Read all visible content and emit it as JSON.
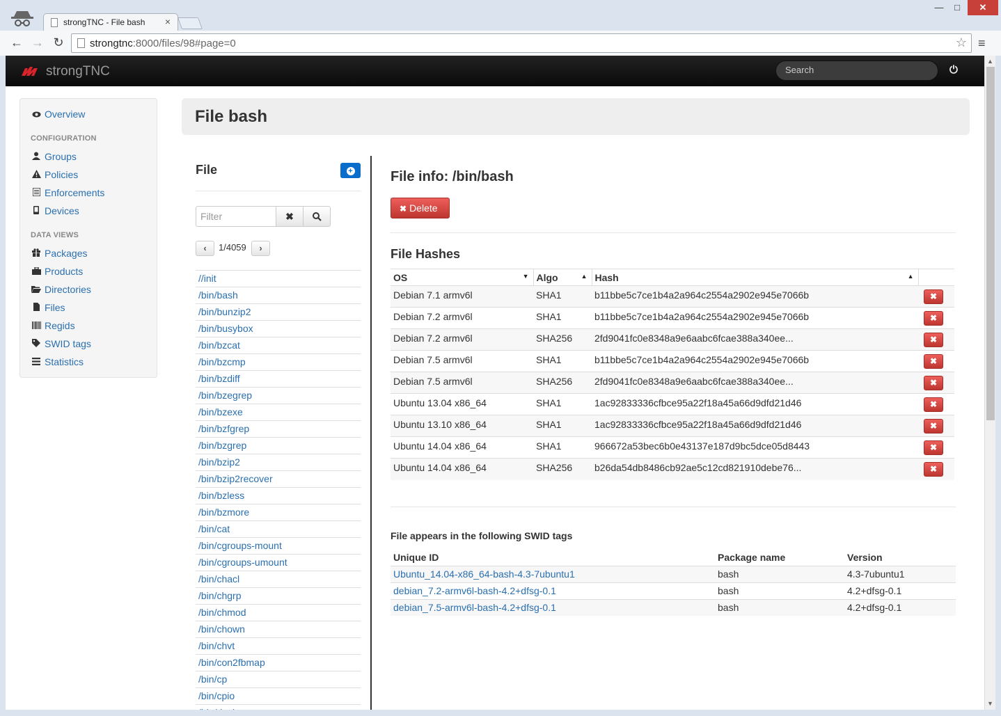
{
  "browser": {
    "tab_title": "strongTNC - File bash",
    "tab_close": "×",
    "url_host": "strongtnc",
    "url_rest": ":8000/files/98#page=0",
    "win_min": "—",
    "win_max": "□",
    "win_close": "✕",
    "back": "←",
    "forward": "→",
    "reload": "↻",
    "star": "☆",
    "menu": "≡"
  },
  "navbar": {
    "brand": "strongTNC",
    "search_placeholder": "Search",
    "power_icon": "⏻",
    "accent": "#d9242b"
  },
  "sidebar": {
    "overview": "Overview",
    "config_header": "CONFIGURATION",
    "config_items": [
      {
        "label": "Groups",
        "icon": "user-icon"
      },
      {
        "label": "Policies",
        "icon": "warning-icon"
      },
      {
        "label": "Enforcements",
        "icon": "list-icon"
      },
      {
        "label": "Devices",
        "icon": "phone-icon"
      }
    ],
    "data_header": "DATA VIEWS",
    "data_items": [
      {
        "label": "Packages",
        "icon": "gift-icon"
      },
      {
        "label": "Products",
        "icon": "briefcase-icon"
      },
      {
        "label": "Directories",
        "icon": "folder-icon"
      },
      {
        "label": "Files",
        "icon": "file-icon"
      },
      {
        "label": "Regids",
        "icon": "barcode-icon"
      },
      {
        "label": "SWID tags",
        "icon": "tag-icon"
      },
      {
        "label": "Statistics",
        "icon": "list-icon"
      }
    ]
  },
  "page": {
    "title": "File bash"
  },
  "file_panel": {
    "title": "File",
    "filter_placeholder": "Filter",
    "clear_glyph": "✖",
    "search_glyph": "⌕",
    "prev_glyph": "‹",
    "next_glyph": "›",
    "page_indicator": "1/4059",
    "files": [
      "//init",
      "/bin/bash",
      "/bin/bunzip2",
      "/bin/busybox",
      "/bin/bzcat",
      "/bin/bzcmp",
      "/bin/bzdiff",
      "/bin/bzegrep",
      "/bin/bzexe",
      "/bin/bzfgrep",
      "/bin/bzgrep",
      "/bin/bzip2",
      "/bin/bzip2recover",
      "/bin/bzless",
      "/bin/bzmore",
      "/bin/cat",
      "/bin/cgroups-mount",
      "/bin/cgroups-umount",
      "/bin/chacl",
      "/bin/chgrp",
      "/bin/chmod",
      "/bin/chown",
      "/bin/chvt",
      "/bin/con2fbmap",
      "/bin/cp",
      "/bin/cpio",
      "/bin/dash"
    ]
  },
  "file_info": {
    "title": "File info: /bin/bash",
    "delete_label": "Delete",
    "hashes_title": "File Hashes",
    "hash_columns": [
      "OS",
      "Algo",
      "Hash",
      ""
    ],
    "hashes": [
      {
        "os": "Debian 7.1 armv6l",
        "algo": "SHA1",
        "hash": "b11bbe5c7ce1b4a2a964c2554a2902e945e7066b"
      },
      {
        "os": "Debian 7.2 armv6l",
        "algo": "SHA1",
        "hash": "b11bbe5c7ce1b4a2a964c2554a2902e945e7066b"
      },
      {
        "os": "Debian 7.2 armv6l",
        "algo": "SHA256",
        "hash": "2fd9041fc0e8348a9e6aabc6fcae388a340ee..."
      },
      {
        "os": "Debian 7.5 armv6l",
        "algo": "SHA1",
        "hash": "b11bbe5c7ce1b4a2a964c2554a2902e945e7066b"
      },
      {
        "os": "Debian 7.5 armv6l",
        "algo": "SHA256",
        "hash": "2fd9041fc0e8348a9e6aabc6fcae388a340ee..."
      },
      {
        "os": "Ubuntu 13.04 x86_64",
        "algo": "SHA1",
        "hash": "1ac92833336cfbce95a22f18a45a66d9dfd21d46"
      },
      {
        "os": "Ubuntu 13.10 x86_64",
        "algo": "SHA1",
        "hash": "1ac92833336cfbce95a22f18a45a66d9dfd21d46"
      },
      {
        "os": "Ubuntu 14.04 x86_64",
        "algo": "SHA1",
        "hash": "966672a53bec6b0e43137e187d9bc5dce05d8443"
      },
      {
        "os": "Ubuntu 14.04 x86_64",
        "algo": "SHA256",
        "hash": "b26da54db8486cb92ae5c12cd821910debe76..."
      }
    ],
    "swid_title": "File appears in the following SWID tags",
    "swid_columns": [
      "Unique ID",
      "Package name",
      "Version"
    ],
    "swid_tags": [
      {
        "unique_id": "Ubuntu_14.04-x86_64-bash-4.3-7ubuntu1",
        "package": "bash",
        "version": "4.3-7ubuntu1"
      },
      {
        "unique_id": "debian_7.2-armv6l-bash-4.2+dfsg-0.1",
        "package": "bash",
        "version": "4.2+dfsg-0.1"
      },
      {
        "unique_id": "debian_7.5-armv6l-bash-4.2+dfsg-0.1",
        "package": "bash",
        "version": "4.2+dfsg-0.1"
      }
    ]
  }
}
